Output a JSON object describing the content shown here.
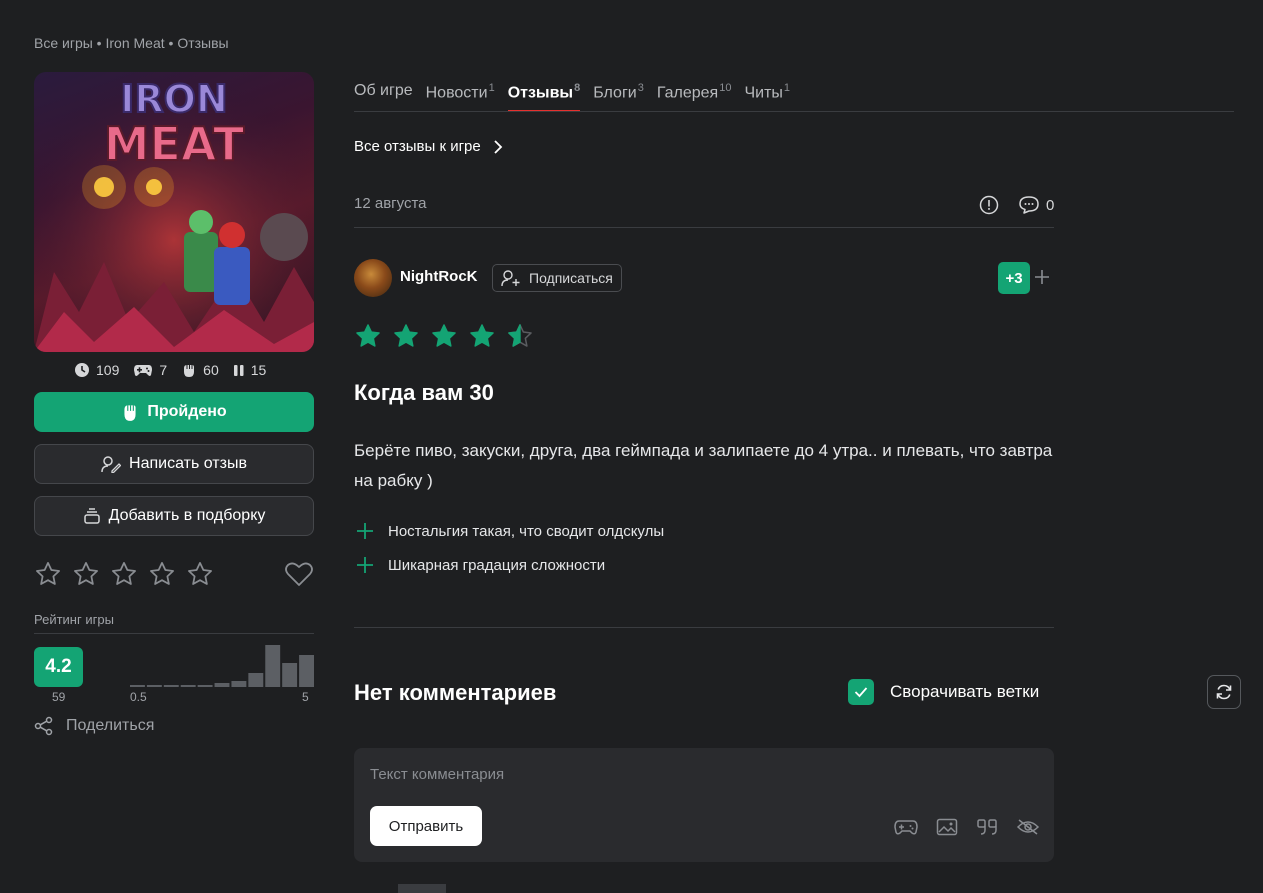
{
  "breadcrumb": [
    "Все игры",
    "Iron Meat",
    "Отзывы"
  ],
  "game": {
    "cover_title": "IRON MEAT",
    "stats": [
      {
        "icon": "clock-icon",
        "value": "109"
      },
      {
        "icon": "gamepad-icon",
        "value": "7"
      },
      {
        "icon": "fist-icon",
        "value": "60"
      },
      {
        "icon": "pause-icon",
        "value": "15"
      }
    ],
    "done_label": "Пройдено",
    "write_review_label": "Написать отзыв",
    "add_collection_label": "Добавить в подборку",
    "rating_title": "Рейтинг игры",
    "rating_value": "4.2",
    "rating_count": "59",
    "hist_min": "0.5",
    "hist_max": "5",
    "hist_values": [
      1,
      1,
      1,
      1,
      1,
      2,
      3,
      7,
      21,
      12,
      16
    ],
    "share_label": "Поделиться"
  },
  "tabs": [
    {
      "label": "Об игре",
      "count": ""
    },
    {
      "label": "Новости",
      "count": "1"
    },
    {
      "label": "Отзывы",
      "count": "8",
      "active": true
    },
    {
      "label": "Блоги",
      "count": "3"
    },
    {
      "label": "Галерея",
      "count": "10"
    },
    {
      "label": "Читы",
      "count": "1"
    }
  ],
  "all_reviews_label": "Все отзывы к игре",
  "review": {
    "date": "12 августа",
    "comments": "0",
    "author": "NightRocK",
    "subscribe_label": "Подписаться",
    "score": "+3",
    "stars": 4.5,
    "title": "Когда вам 30",
    "body": "Берёте пиво, закуски, друга, два геймпада и залипаете до 4 утра.. и плевать, что завтра на рабку )",
    "pros": [
      "Ностальгия такая, что сводит олдскулы",
      "Шикарная градация сложности"
    ]
  },
  "comments": {
    "empty_label": "Нет комментариев",
    "collapse_label": "Сворачивать ветки",
    "placeholder": "Текст комментария",
    "send_label": "Отправить"
  },
  "colors": {
    "accent": "#14a474",
    "tab_underline": "#e5312f",
    "background": "#1e1f21"
  }
}
